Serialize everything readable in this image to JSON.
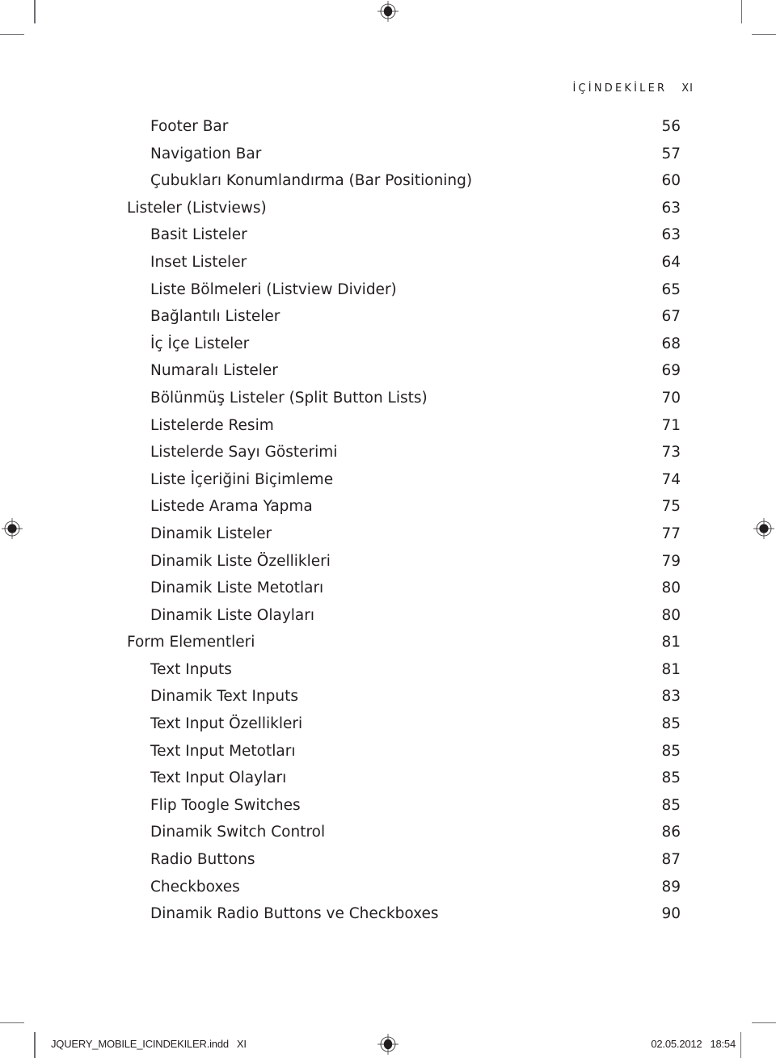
{
  "header": {
    "section_title": "İÇİNDEKİLER",
    "page_folio": "XI"
  },
  "toc": {
    "entries": [
      {
        "title": "Footer Bar",
        "page": "56",
        "level": 2
      },
      {
        "title": "Navigation Bar",
        "page": "57",
        "level": 2
      },
      {
        "title": "Çubukları Konumlandırma (Bar Positioning)",
        "page": "60",
        "level": 2
      },
      {
        "title": "Listeler (Listviews)",
        "page": "63",
        "level": 1
      },
      {
        "title": "Basit Listeler",
        "page": "63",
        "level": 2
      },
      {
        "title": "Inset Listeler",
        "page": "64",
        "level": 2
      },
      {
        "title": "Liste Bölmeleri (Listview Divider)",
        "page": "65",
        "level": 2
      },
      {
        "title": "Bağlantılı Listeler",
        "page": "67",
        "level": 2
      },
      {
        "title": "İç İçe Listeler",
        "page": "68",
        "level": 2
      },
      {
        "title": "Numaralı Listeler",
        "page": "69",
        "level": 2
      },
      {
        "title": "Bölünmüş Listeler (Split Button Lists)",
        "page": "70",
        "level": 2
      },
      {
        "title": "Listelerde Resim",
        "page": "71",
        "level": 2
      },
      {
        "title": "Listelerde Sayı Gösterimi",
        "page": "73",
        "level": 2
      },
      {
        "title": "Liste İçeriğini Biçimleme",
        "page": "74",
        "level": 2
      },
      {
        "title": "Listede Arama Yapma",
        "page": "75",
        "level": 2
      },
      {
        "title": "Dinamik Listeler",
        "page": "77",
        "level": 2
      },
      {
        "title": "Dinamik Liste Özellikleri",
        "page": "79",
        "level": 2
      },
      {
        "title": "Dinamik Liste Metotları",
        "page": "80",
        "level": 2
      },
      {
        "title": "Dinamik Liste Olayları",
        "page": "80",
        "level": 2
      },
      {
        "title": "Form Elementleri",
        "page": "81",
        "level": 1
      },
      {
        "title": "Text Inputs",
        "page": "81",
        "level": 2
      },
      {
        "title": "Dinamik Text Inputs",
        "page": "83",
        "level": 2
      },
      {
        "title": "Text Input Özellikleri",
        "page": "85",
        "level": 2
      },
      {
        "title": "Text Input Metotları",
        "page": "85",
        "level": 2
      },
      {
        "title": "Text Input Olayları",
        "page": "85",
        "level": 2
      },
      {
        "title": "Flip Toogle Switches",
        "page": "85",
        "level": 2
      },
      {
        "title": "Dinamik Switch Control",
        "page": "86",
        "level": 2
      },
      {
        "title": "Radio Buttons",
        "page": "87",
        "level": 2
      },
      {
        "title": "Checkboxes",
        "page": "89",
        "level": 2
      },
      {
        "title": "Dinamik Radio Buttons ve Checkboxes",
        "page": "90",
        "level": 2
      }
    ]
  },
  "slug": {
    "filename": "JQUERY_MOBILE_ICINDEKILER.indd",
    "page": "XI",
    "date": "02.05.2012",
    "time": "18:54"
  },
  "icons": {
    "registration_mark": "registration-mark-icon",
    "crop_mark": "crop-mark"
  }
}
